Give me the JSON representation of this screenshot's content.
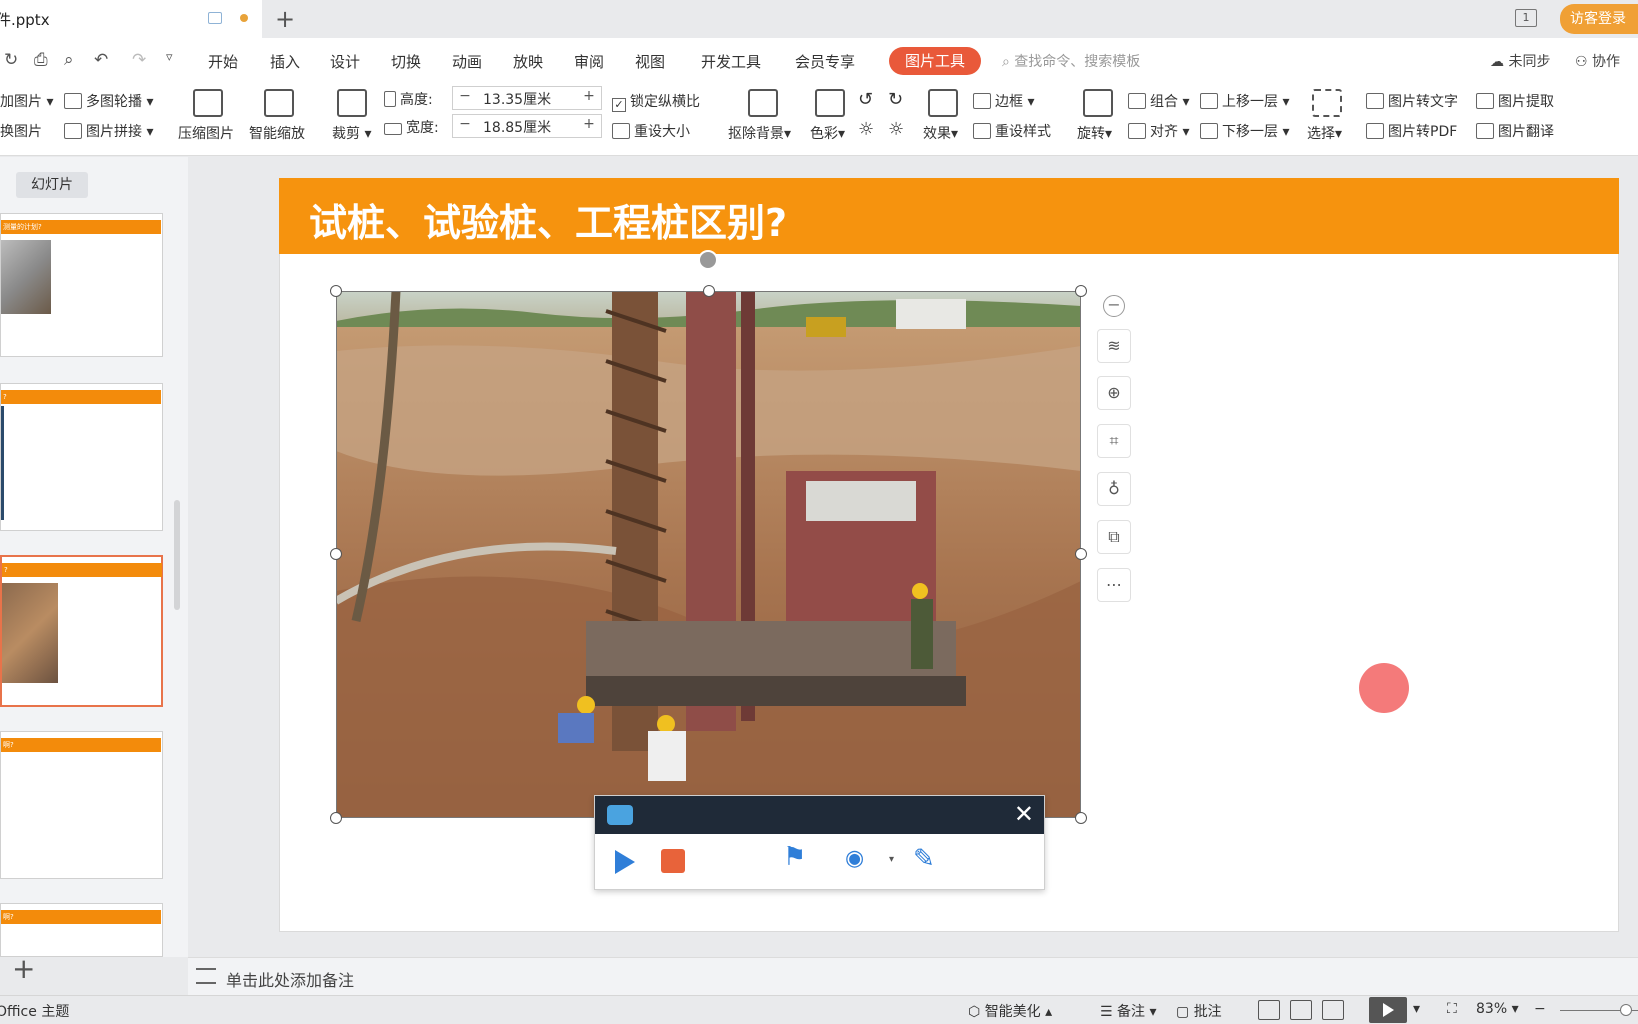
{
  "titlebar": {
    "doc_name": "课件.pptx",
    "doc_name_visible": "件.pptx",
    "window_count": "1",
    "guest_login": "访客登录"
  },
  "menubar": {
    "items": [
      "开始",
      "插入",
      "设计",
      "切换",
      "动画",
      "放映",
      "审阅",
      "视图",
      "开发工具",
      "会员专享"
    ],
    "active": "图片工具",
    "search_placeholder": "查找命令、搜索模板",
    "sync": "未同步",
    "collab": "协作"
  },
  "ribbon": {
    "add_picture": "加图片",
    "replace_picture": "换图片",
    "multi_carousel": "多图轮播",
    "picture_splice": "图片拼接",
    "compress": "压缩图片",
    "smart_zoom": "智能缩放",
    "crop": "裁剪",
    "height_label": "高度:",
    "height_value": "13.35厘米",
    "width_label": "宽度:",
    "width_value": "18.85厘米",
    "lock_ratio": "锁定纵横比",
    "reset_size": "重设大小",
    "remove_bg": "抠除背景",
    "color": "色彩",
    "effects": "效果",
    "border": "边框",
    "reset_style": "重设样式",
    "rotate": "旋转",
    "group": "组合",
    "align": "对齐",
    "bring_forward": "上移一层",
    "send_backward": "下移一层",
    "select": "选择",
    "pic_to_text": "图片转文字",
    "pic_extract": "图片提取",
    "pic_to_pdf": "图片转PDF",
    "pic_translate": "图片翻译"
  },
  "left_panel": {
    "tab": "幻灯片",
    "thumb_titles": [
      "测量的计划?",
      "?",
      "?",
      "啊?",
      "啊?"
    ]
  },
  "slide": {
    "title": "试桩、试验桩、工程桩区别?"
  },
  "notes": {
    "placeholder": "单击此处添加备注"
  },
  "status": {
    "theme": "Office 主题",
    "smart_beautify": "智能美化",
    "notes": "备注",
    "comment": "批注",
    "zoom": "83%"
  },
  "colors": {
    "accent_orange": "#f6930e",
    "active_tab": "#e9593a",
    "recorder_blue": "#2f7ed8",
    "recorder_stop": "#e8633a",
    "pink_dot": "#f47a7a"
  }
}
